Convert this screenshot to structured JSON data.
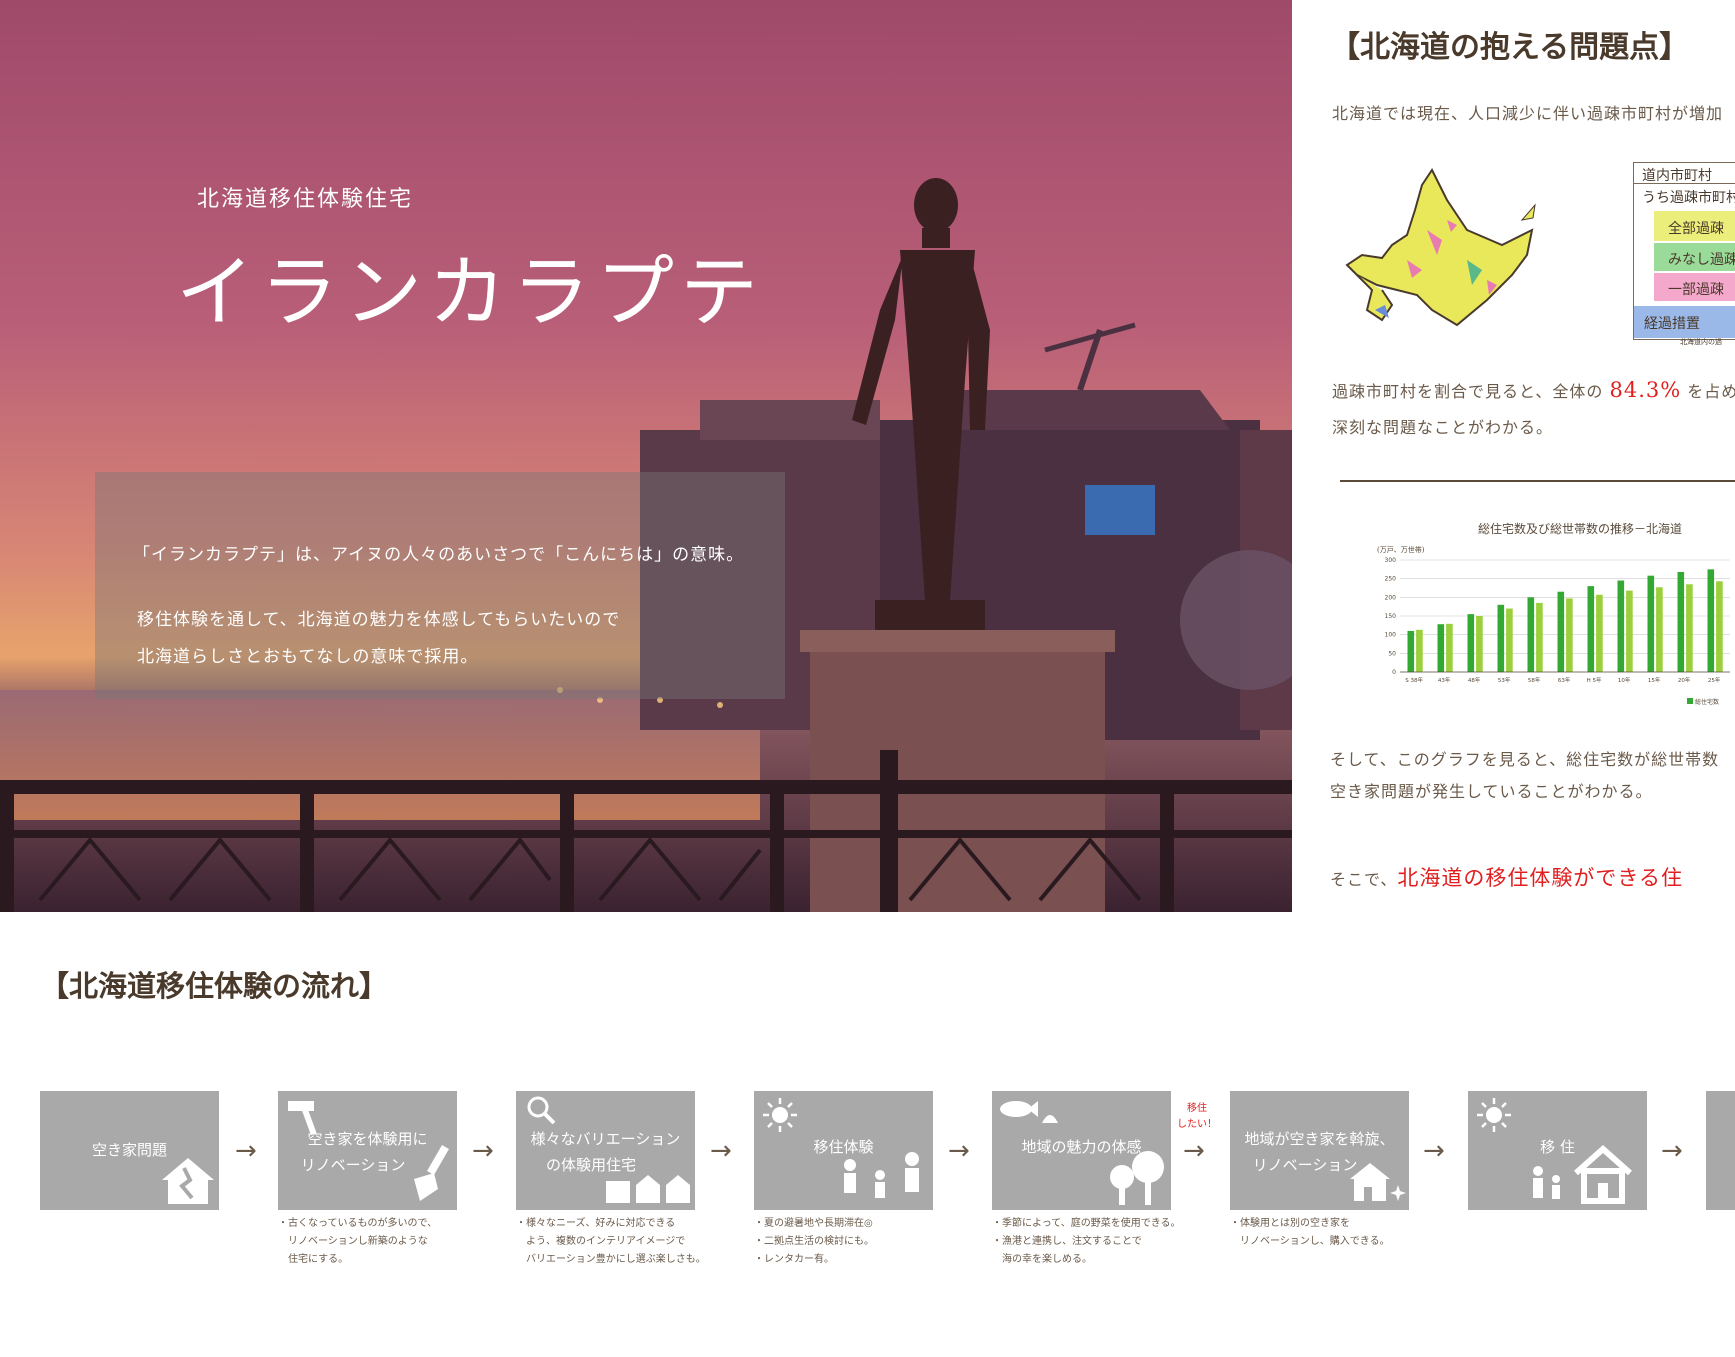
{
  "hero": {
    "subtitle": "北海道移住体験住宅",
    "title": "イランカラプテ",
    "box_line1": "「イランカラプテ」は、アイヌの人々のあいさつで「こんにちは」の意味。",
    "box_line2": "移住体験を通して、北海道の魅力を体感してもらいたいので",
    "box_line3": "北海道らしさとおもてなしの意味で採用。"
  },
  "problems": {
    "title": "【北海道の抱える問題点】",
    "intro": "北海道では現在、人口減少に伴い過疎市町村が増加",
    "legend": {
      "header1": "道内市町村",
      "header2": "うち過疎市町村",
      "item1": "全部過疎",
      "item2": "みなし過疎",
      "item3": "一部過疎",
      "item4": "経過措置",
      "footnote": "北海道内の過"
    },
    "ratio_prefix": "過疎市町村を割合で見ると、全体の",
    "ratio_value": "84.3%",
    "ratio_suffix": "を占め",
    "ratio_line2": "深刻な問題なことがわかる。",
    "chart_title": "総住宅数及び総世帯数の推移－北海道",
    "chart_unit": "(万戸、万世帯)",
    "graph_line1": "そして、このグラフを見ると、総住宅数が総世帯数",
    "graph_line2": "空き家問題が発生していることがわかる。",
    "conclusion_prefix": "そこで、",
    "conclusion_red": "北海道の移住体験ができる住"
  },
  "chart_data": {
    "type": "bar",
    "title": "総住宅数及び総世帯数の推移－北海道",
    "ylabel": "(万戸、万世帯)",
    "categories": [
      "S 38年",
      "43年",
      "48年",
      "53年",
      "58年",
      "63年",
      "H 5年",
      "10年",
      "15年",
      "20年",
      "25年"
    ],
    "ylim": [
      0,
      300
    ],
    "yticks": [
      0,
      50,
      100,
      150,
      200,
      250,
      300
    ],
    "series": [
      {
        "name": "総住宅数",
        "color": "#33a833",
        "values": [
          110,
          128,
          155,
          180,
          200,
          215,
          230,
          245,
          258,
          268,
          275
        ]
      },
      {
        "name": "",
        "color": "#9ccf3c",
        "values": [
          113,
          129,
          150,
          170,
          185,
          197,
          207,
          218,
          227,
          235,
          243
        ]
      }
    ],
    "legend_position": "bottom-right"
  },
  "flow": {
    "title": "【北海道移住体験の流れ】",
    "arrow": "→",
    "move_note_line1": "移住",
    "move_note_line2": "したい！",
    "steps": [
      {
        "line1": "空き家問題",
        "line2": "",
        "desc": [
          "",
          "",
          ""
        ]
      },
      {
        "line1": "空き家を体験用に",
        "line2": "リノベーション",
        "desc": [
          "・古くなっているものが多いので、",
          "　リノベーションし新築のような",
          "　住宅にする。"
        ]
      },
      {
        "line1": "様々なバリエーション",
        "line2": "の体験用住宅",
        "desc": [
          "・様々なニーズ、好みに対応できる",
          "　よう、複数のインテリアイメージで",
          "　バリエーション豊かにし選ぶ楽しさも。"
        ]
      },
      {
        "line1": "移住体験",
        "line2": "",
        "desc": [
          "・夏の避暑地や長期滞在◎",
          "・二拠点生活の検討にも。",
          "・レンタカー有。"
        ]
      },
      {
        "line1": "地域の魅力の体感",
        "line2": "",
        "desc": [
          "・季節によって、庭の野菜を使用できる。",
          "・漁港と連携し、注文することで",
          "　海の幸を楽しめる。"
        ]
      },
      {
        "line1": "地域が空き家を斡旋、",
        "line2": "リノベーション",
        "desc": [
          "・体験用とは別の空き家を",
          "　リノベーションし、購入できる。",
          ""
        ]
      },
      {
        "line1": "移 住",
        "line2": "",
        "desc": [
          "",
          "",
          ""
        ]
      }
    ]
  }
}
